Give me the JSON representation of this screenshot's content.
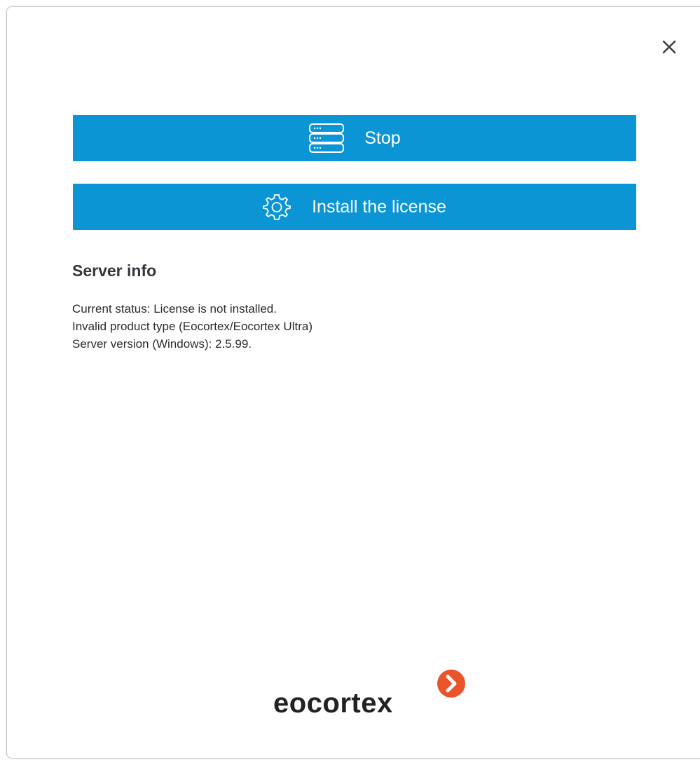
{
  "window": {
    "close_label": "Close"
  },
  "actions": {
    "stop_label": "Stop",
    "install_license_label": "Install the license"
  },
  "server_info": {
    "title": "Server info",
    "lines": [
      "Current status: License is not installed.",
      "Invalid product type (Eocortex/Eocortex Ultra)",
      "Server version (Windows): 2.5.99."
    ]
  },
  "logo": {
    "text": "eocortex"
  },
  "colors": {
    "accent": "#0b95d4",
    "logo_mark": "#e9542b",
    "heading": "#33383d"
  },
  "icons": {
    "close": "close-icon",
    "stop": "server-icon",
    "license": "gear-icon",
    "logo": "chevron-right-icon"
  }
}
